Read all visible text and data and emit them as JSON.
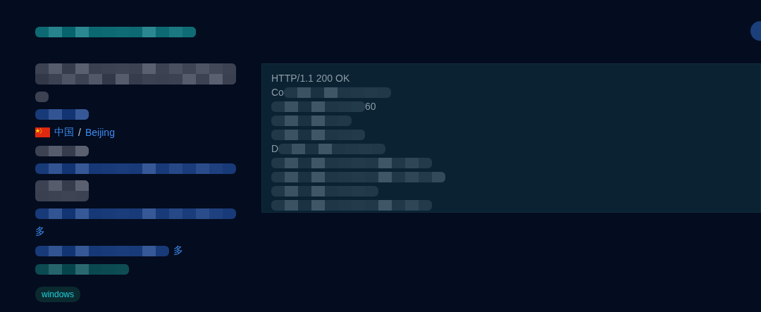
{
  "header": {
    "kind": "redacted",
    "color": "#0e6a72"
  },
  "profile": [
    {
      "kind": "redacted",
      "color": "#3c4252"
    },
    {
      "kind": "redacted",
      "color": "#3c4252"
    },
    {
      "kind": "redacted",
      "color": "#183a78"
    },
    {
      "kind": "location",
      "country": "中国",
      "separator": "/",
      "city": "Beijing"
    },
    {
      "kind": "redacted",
      "color": "#3c4252"
    },
    {
      "kind": "redacted",
      "color": "#183a78"
    },
    {
      "kind": "redacted",
      "color": "#3c4252"
    },
    {
      "kind": "redacted",
      "color": "#183a78"
    },
    {
      "kind": "fragment",
      "text": "多"
    },
    {
      "kind": "redacted",
      "color": "#183a78",
      "trail": "多"
    },
    {
      "kind": "redacted",
      "color": "#0c4a52"
    }
  ],
  "tag": "windows",
  "response": [
    {
      "kind": "text",
      "text": "HTTP/1.1 200 OK"
    },
    {
      "kind": "partial",
      "text": "Co"
    },
    {
      "kind": "partial_end",
      "text": "60"
    },
    {
      "kind": "redacted"
    },
    {
      "kind": "redacted"
    },
    {
      "kind": "partial",
      "text": "D"
    },
    {
      "kind": "redacted"
    },
    {
      "kind": "redacted"
    },
    {
      "kind": "redacted"
    },
    {
      "kind": "redacted"
    }
  ]
}
